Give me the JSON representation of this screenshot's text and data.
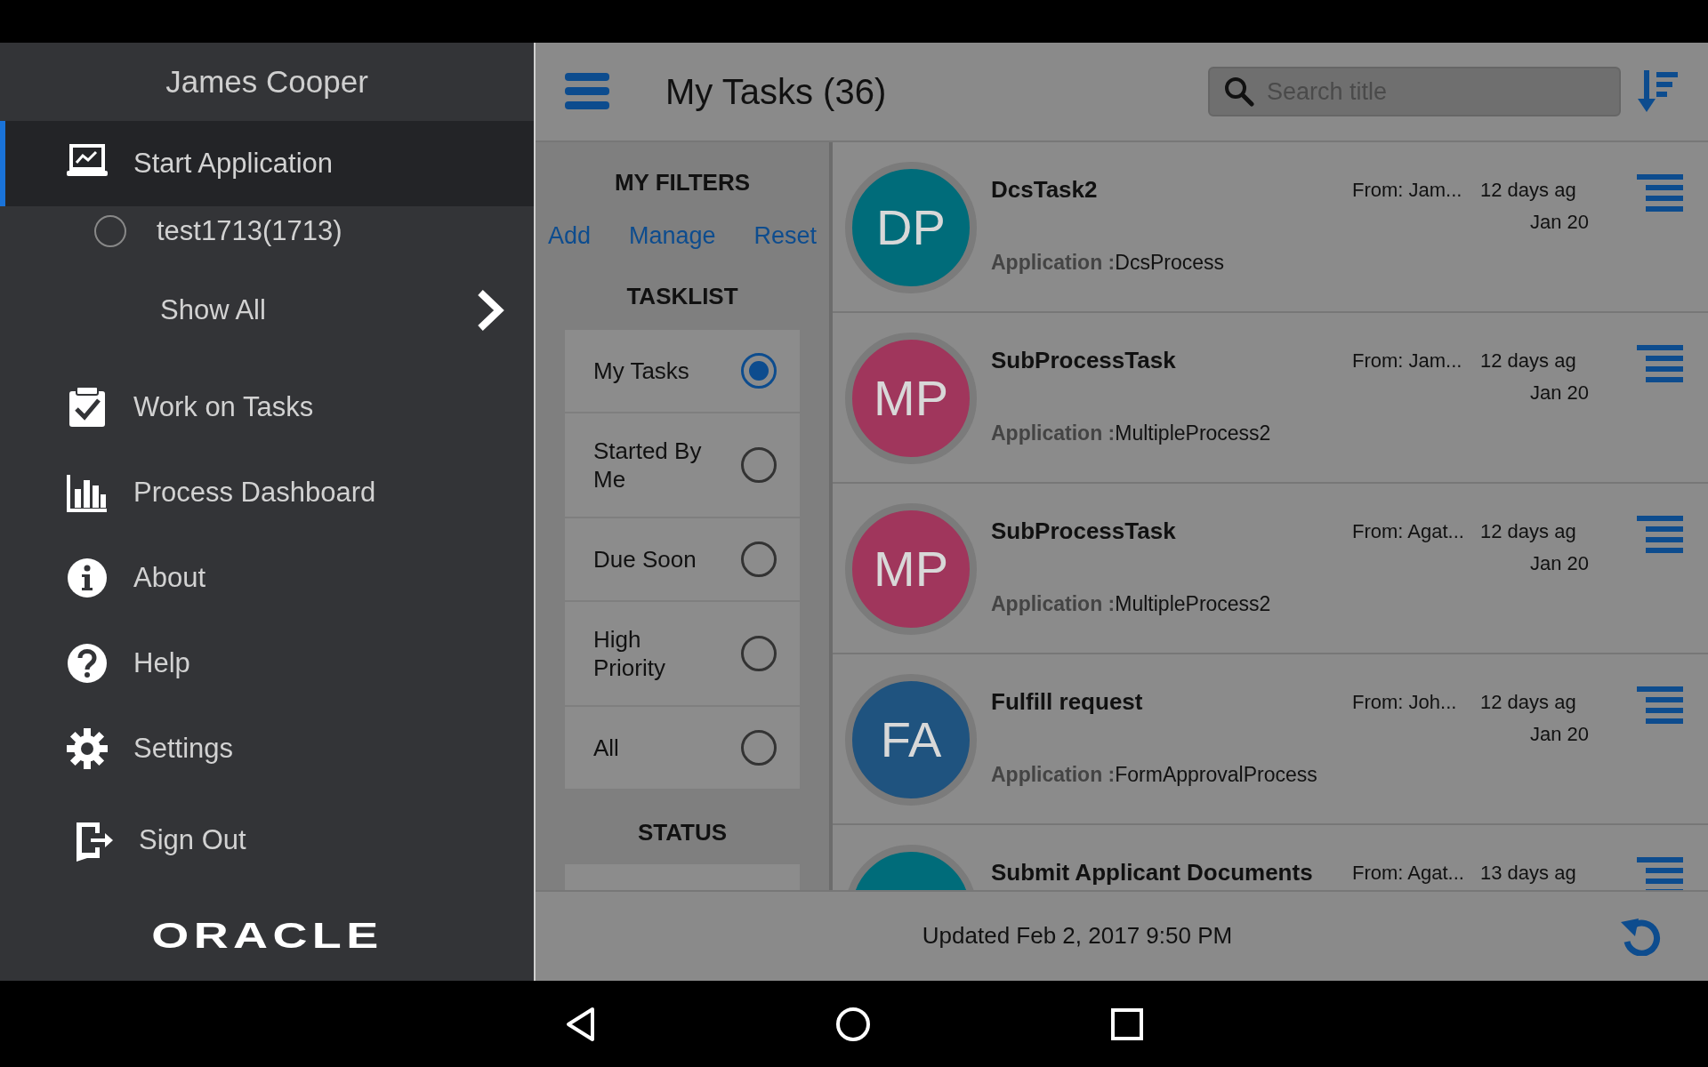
{
  "drawer": {
    "user_name": "James Cooper",
    "menu": [
      {
        "label": "Start Application",
        "selected": true,
        "children": [
          {
            "label": "test1713(1713)",
            "selected": false
          }
        ],
        "more_link": "Show All"
      },
      {
        "label": "Work on Tasks",
        "selected": false
      },
      {
        "label": "Process Dashboard",
        "selected": false
      },
      {
        "label": "About",
        "selected": false
      },
      {
        "label": "Help",
        "selected": false
      },
      {
        "label": "Settings",
        "selected": false
      },
      {
        "label": "Sign Out",
        "selected": false
      }
    ],
    "logo": "ORACLE"
  },
  "header": {
    "title": "My Tasks (36)",
    "search": {
      "placeholder": "Search title"
    }
  },
  "filters": {
    "heading": "MY FILTERS",
    "actions": [
      "Add",
      "Manage",
      "Reset"
    ],
    "tasklist_heading": "TASKLIST",
    "tasklist": [
      {
        "label": "My Tasks",
        "selected": true
      },
      {
        "label": "Started By Me",
        "selected": false
      },
      {
        "label": "Due Soon",
        "selected": false
      },
      {
        "label": "High Priority",
        "selected": false
      },
      {
        "label": "All",
        "selected": false
      }
    ],
    "status_heading": "STATUS"
  },
  "tasks": [
    {
      "initials": "DP",
      "color": "#006c7a",
      "title": "DcsTask2",
      "from": "From: Jam...",
      "age": "12 days ag",
      "date": "Jan 20",
      "application_label": "Application :",
      "application": "DcsProcess"
    },
    {
      "initials": "MP",
      "color": "#a0365c",
      "title": "SubProcessTask",
      "from": "From: Jam...",
      "age": "12 days ag",
      "date": "Jan 20",
      "application_label": "Application :",
      "application": "MultipleProcess2"
    },
    {
      "initials": "MP",
      "color": "#a0365c",
      "title": "SubProcessTask",
      "from": "From: Agat...",
      "age": "12 days ag",
      "date": "Jan 20",
      "application_label": "Application :",
      "application": "MultipleProcess2"
    },
    {
      "initials": "FA",
      "color": "#1f537f",
      "title": "Fulfill request",
      "from": "From: Joh...",
      "age": "12 days ag",
      "date": "Jan 20",
      "application_label": "Application :",
      "application": "FormApprovalProcess"
    },
    {
      "color": "#006c7a",
      "title": "Submit Applicant Documents",
      "from": "From: Agat...",
      "age": "13 days ag"
    }
  ],
  "footer": {
    "updated": "Updated Feb 2, 2017 9:50 PM"
  }
}
